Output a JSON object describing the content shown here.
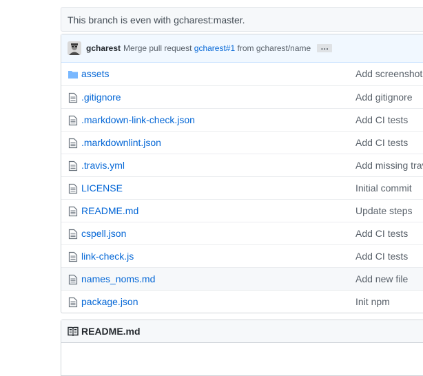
{
  "branch_status": "This branch is even with gcharest:master.",
  "commit": {
    "author": "gcharest",
    "message_prefix": "Merge pull request",
    "pr_link": "gcharest#1",
    "message_suffix": "from gcharest/name",
    "ellipsis": "…"
  },
  "files": [
    {
      "type": "directory",
      "name": "assets",
      "message": "Add screenshots"
    },
    {
      "type": "file",
      "name": ".gitignore",
      "message": "Add gitignore"
    },
    {
      "type": "file",
      "name": ".markdown-link-check.json",
      "message": "Add CI tests"
    },
    {
      "type": "file",
      "name": ".markdownlint.json",
      "message": "Add CI tests"
    },
    {
      "type": "file",
      "name": ".travis.yml",
      "message": "Add missing travis"
    },
    {
      "type": "file",
      "name": "LICENSE",
      "message": "Initial commit"
    },
    {
      "type": "file",
      "name": "README.md",
      "message": "Update steps"
    },
    {
      "type": "file",
      "name": "cspell.json",
      "message": "Add CI tests"
    },
    {
      "type": "file",
      "name": "link-check.js",
      "message": "Add CI tests"
    },
    {
      "type": "file",
      "name": "names_noms.md",
      "message": "Add new file"
    },
    {
      "type": "file",
      "name": "package.json",
      "message": "Init npm"
    }
  ],
  "readme": {
    "title": "README.md"
  },
  "colors": {
    "link": "#0366d6",
    "folder": "#79b8ff",
    "file_icon": "#6a737d"
  }
}
